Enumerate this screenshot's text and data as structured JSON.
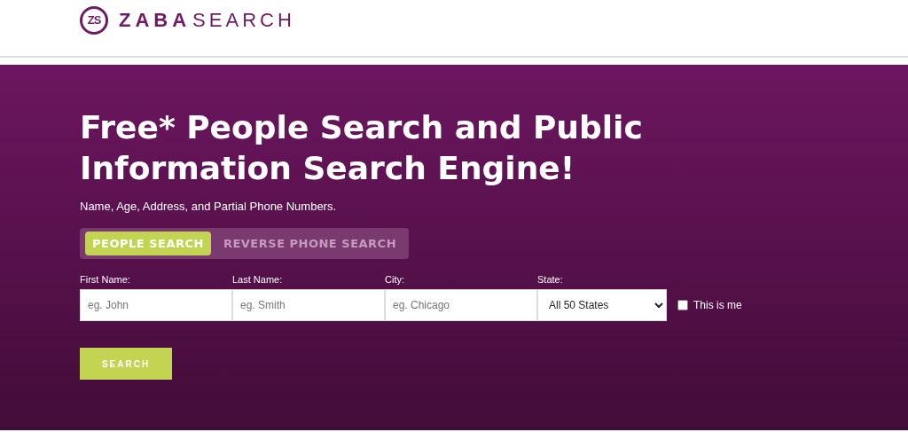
{
  "logo": {
    "mark": "ZS",
    "brand_bold": "ZABA",
    "brand_light": "SEARCH"
  },
  "hero": {
    "title": "Free* People Search and Public Information Search Engine!",
    "subtitle": "Name, Age, Address, and Partial Phone Numbers."
  },
  "tabs": [
    {
      "label": "PEOPLE SEARCH",
      "selected": true
    },
    {
      "label": "REVERSE PHONE SEARCH",
      "selected": false
    }
  ],
  "fields": [
    {
      "kind": "text",
      "label": "First Name:",
      "placeholder": "eg. John"
    },
    {
      "kind": "text",
      "label": "Last Name:",
      "placeholder": "eg. Smith"
    },
    {
      "kind": "text",
      "label": "City:",
      "placeholder": "eg. Chicago"
    },
    {
      "kind": "select",
      "label": "State:",
      "value": "All 50 States"
    }
  ],
  "this_is_me": {
    "label": "This is me",
    "checked": false
  },
  "search_button": "SEARCH"
}
